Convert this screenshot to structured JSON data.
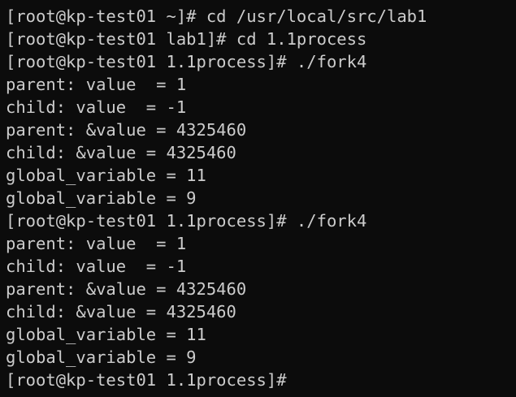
{
  "terminal": {
    "lines": [
      "[root@kp-test01 ~]# cd /usr/local/src/lab1",
      "[root@kp-test01 lab1]# cd 1.1process",
      "[root@kp-test01 1.1process]# ./fork4",
      "parent: value  = 1",
      "child: value  = -1",
      "parent: &value = 4325460",
      "child: &value = 4325460",
      "global_variable = 11",
      "global_variable = 9",
      "[root@kp-test01 1.1process]# ./fork4",
      "parent: value  = 1",
      "child: value  = -1",
      "parent: &value = 4325460",
      "child: &value = 4325460",
      "global_variable = 11",
      "global_variable = 9",
      "[root@kp-test01 1.1process]#"
    ]
  },
  "colors": {
    "background": "#0c0c0c",
    "foreground": "#cccccc"
  }
}
